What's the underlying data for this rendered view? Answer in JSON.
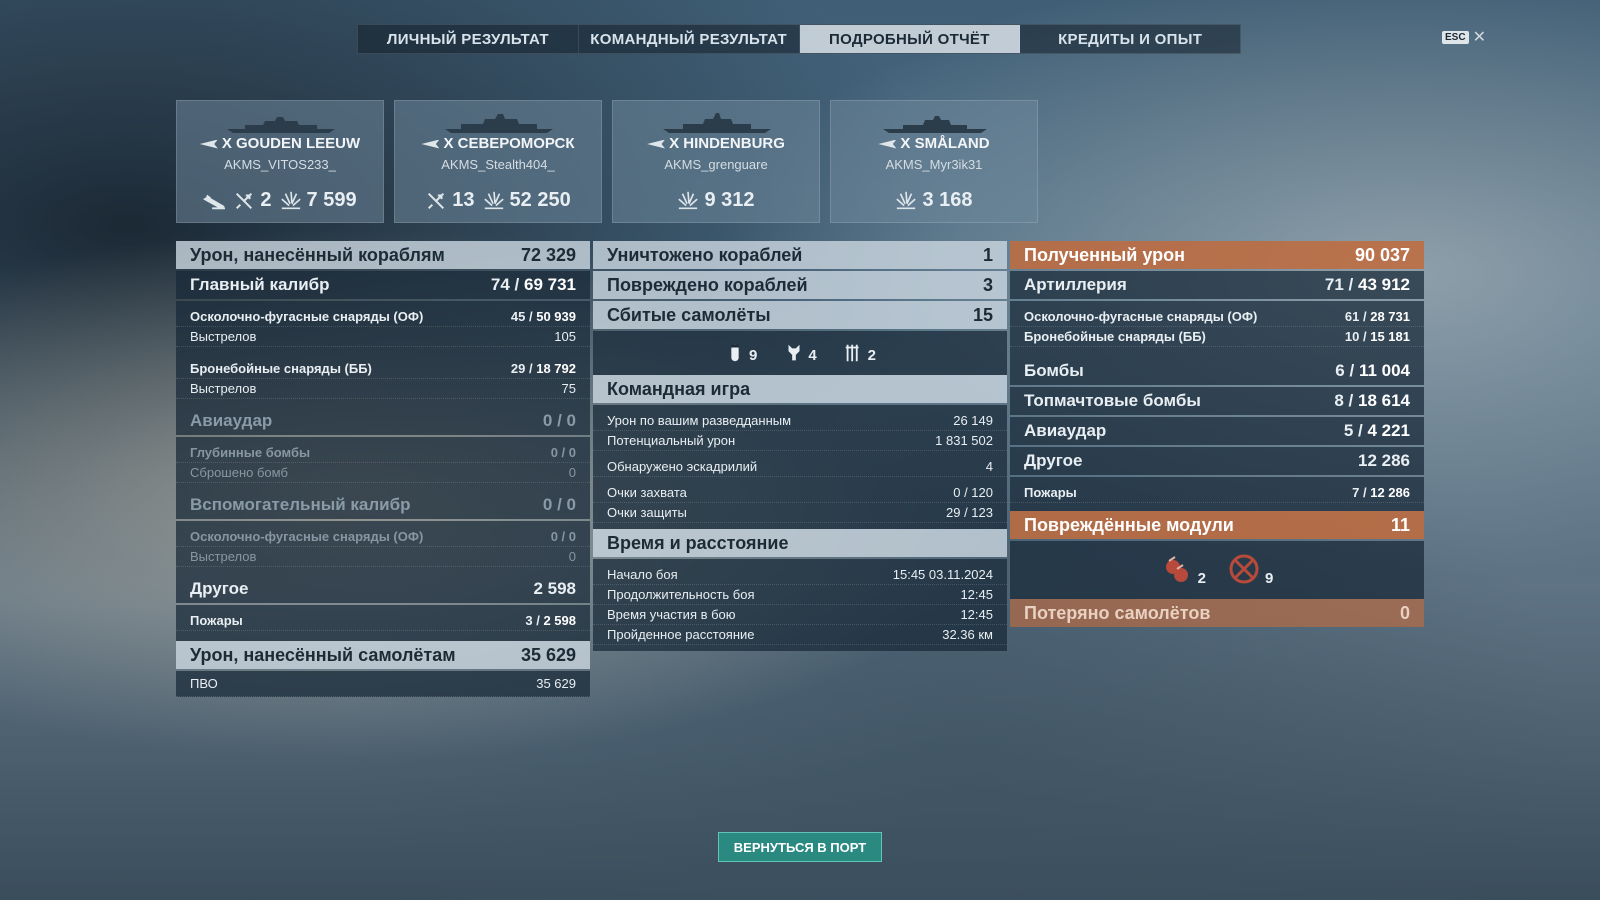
{
  "tabs": [
    "Личный результат",
    "Командный результат",
    "Подробный отчёт",
    "Кредиты и опыт"
  ],
  "esc_label": "ESC",
  "ships": [
    {
      "name": "X GOUDEN LEEUW",
      "player": "AKMS_VITOS233_",
      "planes": "2",
      "damage": "7 599"
    },
    {
      "name": "X СЕВЕРОМОРСК",
      "player": "AKMS_Stealth404_",
      "planes": "13",
      "damage": "52 250"
    },
    {
      "name": "X HINDENBURG",
      "player": "AKMS_grenguare",
      "damage": "9 312"
    },
    {
      "name": "X SMÅLAND",
      "player": "AKMS_Myr3ik31",
      "damage": "3 168"
    }
  ],
  "left": {
    "ship_damage": {
      "label": "Урон, нанесённый кораблям",
      "value": "72 329"
    },
    "main_battery": {
      "label": "Главный калибр",
      "hits": "74",
      "value": "69 731"
    },
    "he": {
      "label": "Осколочно-фугасные снаряды (ОФ)",
      "hits": "45",
      "value": "50 939"
    },
    "he_shots": {
      "label": "Выстрелов",
      "value": "105"
    },
    "ap": {
      "label": "Бронебойные снаряды (ББ)",
      "hits": "29",
      "value": "18 792"
    },
    "ap_shots": {
      "label": "Выстрелов",
      "value": "75"
    },
    "airstrike": {
      "label": "Авиаудар",
      "hits": "0",
      "value": "0"
    },
    "depth": {
      "label": "Глубинные бомбы",
      "hits": "0",
      "value": "0"
    },
    "bombs_dropped": {
      "label": "Сброшено бомб",
      "value": "0"
    },
    "secondary": {
      "label": "Вспомогательный калибр",
      "hits": "0",
      "value": "0"
    },
    "sec_he": {
      "label": "Осколочно-фугасные снаряды (ОФ)",
      "hits": "0",
      "value": "0"
    },
    "sec_shots": {
      "label": "Выстрелов",
      "value": "0"
    },
    "other": {
      "label": "Другое",
      "value": "2 598"
    },
    "fires": {
      "label": "Пожары",
      "hits": "3",
      "value": "2 598"
    },
    "plane_damage": {
      "label": "Урон, нанесённый самолётам",
      "value": "35 629"
    },
    "aa": {
      "label": "ПВО",
      "value": "35 629"
    }
  },
  "mid": {
    "destroyed": {
      "label": "Уничтожено кораблей",
      "value": "1"
    },
    "damaged": {
      "label": "Повреждено кораблей",
      "value": "3"
    },
    "planes": {
      "label": "Сбитые самолёты",
      "value": "15"
    },
    "plane_icons": [
      {
        "icon": "bomber-icon",
        "count": "9"
      },
      {
        "icon": "fighter-icon",
        "count": "4"
      },
      {
        "icon": "torpedo-bomber-icon",
        "count": "2"
      }
    ],
    "team": {
      "label": "Командная игра"
    },
    "spot_dmg": {
      "label": "Урон по вашим разведданным",
      "value": "26 149"
    },
    "potential": {
      "label": "Потенциальный урон",
      "value": "1 831 502"
    },
    "squadrons": {
      "label": "Обнаружено эскадрилий",
      "value": "4"
    },
    "capture": {
      "label": "Очки захвата",
      "value": "0 / 120"
    },
    "defense": {
      "label": "Очки защиты",
      "value": "29 / 123"
    },
    "time": {
      "label": "Время и расстояние"
    },
    "start": {
      "label": "Начало боя",
      "value": "15:45  03.11.2024"
    },
    "duration": {
      "label": "Продолжительность боя",
      "value": "12:45"
    },
    "participation": {
      "label": "Время участия в бою",
      "value": "12:45"
    },
    "distance": {
      "label": "Пройденное расстояние",
      "value": "32.36 км"
    }
  },
  "right": {
    "received": {
      "label": "Полученный урон",
      "value": "90 037"
    },
    "artillery": {
      "label": "Артиллерия",
      "hits": "71",
      "value": "43 912"
    },
    "he": {
      "label": "Осколочно-фугасные снаряды (ОФ)",
      "hits": "61",
      "value": "28 731"
    },
    "ap": {
      "label": "Бронебойные снаряды (ББ)",
      "hits": "10",
      "value": "15 181"
    },
    "bombs": {
      "label": "Бомбы",
      "hits": "6",
      "value": "11 004"
    },
    "skip": {
      "label": "Топмачтовые бомбы",
      "hits": "8",
      "value": "18 614"
    },
    "airstrike": {
      "label": "Авиаудар",
      "hits": "5",
      "value": "4 221"
    },
    "other": {
      "label": "Другое",
      "value": "12 286"
    },
    "fires": {
      "label": "Пожары",
      "hits": "7",
      "value": "12 286"
    },
    "modules": {
      "label": "Повреждённые модули",
      "value": "11"
    },
    "module_icons": [
      {
        "icon": "guns-module-icon",
        "count": "2"
      },
      {
        "icon": "aa-module-icon",
        "count": "9"
      }
    ],
    "lost_planes": {
      "label": "Потеряно самолётов",
      "value": "0"
    }
  },
  "port_button": "Вернуться в порт",
  "colors": {
    "orange": "#be6c40",
    "teal": "#2a8a82",
    "header_light": "#c8d4de"
  }
}
